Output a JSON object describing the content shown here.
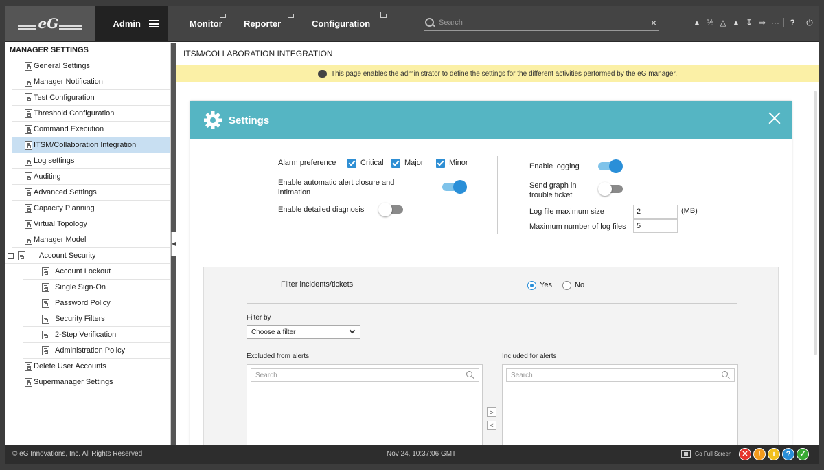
{
  "topbar": {
    "logo_text": "eG",
    "admin_label": "Admin",
    "nav": [
      "Monitor",
      "Reporter",
      "Configuration"
    ],
    "search_placeholder": "Search",
    "search_clear": "×",
    "tool_icons": [
      "user-icon",
      "link-icon",
      "alert-icon",
      "bell-icon",
      "download-icon",
      "signout-icon",
      "more-icon",
      "help-icon",
      "power-icon"
    ]
  },
  "sidebar": {
    "title": "MANAGER SETTINGS",
    "items": [
      {
        "label": "General Settings"
      },
      {
        "label": "Manager Notification"
      },
      {
        "label": "Test Configuration"
      },
      {
        "label": "Threshold Configuration"
      },
      {
        "label": "Command Execution"
      },
      {
        "label": "ITSM/Collaboration Integration",
        "active": true
      },
      {
        "label": "Log settings"
      },
      {
        "label": "Auditing"
      },
      {
        "label": "Advanced Settings"
      },
      {
        "label": "Capacity Planning"
      },
      {
        "label": "Virtual Topology"
      },
      {
        "label": "Manager Model"
      }
    ],
    "group": {
      "label": "Account Security",
      "children": [
        "Account Lockout",
        "Single Sign-On",
        "Password Policy",
        "Security Filters",
        "2-Step Verification",
        "Administration Policy"
      ]
    },
    "after": [
      "Delete User Accounts",
      "Supermanager Settings"
    ]
  },
  "main": {
    "title": "ITSM/COLLABORATION INTEGRATION",
    "info": "This page enables the administrator to define the settings for the different activities performed by the eG manager.",
    "card": {
      "title": "Settings",
      "alarm_label": "Alarm preference",
      "alarms": [
        {
          "label": "Critical",
          "checked": true
        },
        {
          "label": "Major",
          "checked": true
        },
        {
          "label": "Minor",
          "checked": true
        }
      ],
      "auto_close_label": "Enable automatic alert closure and intimation",
      "auto_close_on": true,
      "diagnosis_label": "Enable detailed diagnosis",
      "diagnosis_on": false,
      "logging_label": "Enable logging",
      "logging_on": true,
      "graph_label": "Send graph in trouble ticket",
      "graph_on": false,
      "log_size_label": "Log file maximum size",
      "log_size_value": "2",
      "log_size_unit": "(MB)",
      "log_files_label": "Maximum number of log files",
      "log_files_value": "5",
      "filter": {
        "label": "Filter incidents/tickets",
        "yes": "Yes",
        "no": "No",
        "selected": "Yes",
        "filter_by_label": "Filter by",
        "filter_by_value": "Choose a filter",
        "excluded_label": "Excluded from alerts",
        "included_label": "Included for alerts",
        "search_placeholder": "Search",
        "move_right": ">",
        "move_left": "<"
      }
    }
  },
  "footer": {
    "copyright": "© eG Innovations, Inc. All Rights Reserved",
    "time": "Nov 24, 10:37:06 GMT",
    "fullscreen": "Go Full Screen",
    "status": [
      {
        "symbol": "✕",
        "color": "#e5322d"
      },
      {
        "symbol": "!",
        "color": "#f29a1d"
      },
      {
        "symbol": "i",
        "color": "#f2c01d"
      },
      {
        "symbol": "?",
        "color": "#2a8fd8"
      },
      {
        "symbol": "✓",
        "color": "#3aaa35"
      }
    ]
  }
}
